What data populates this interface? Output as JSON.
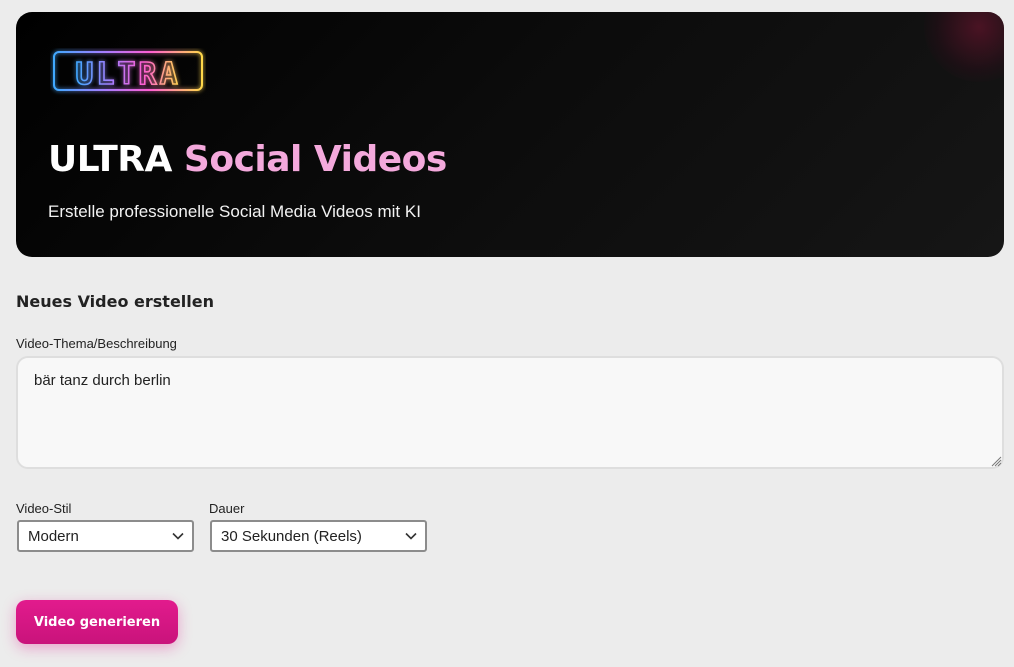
{
  "hero": {
    "logo_text": "ULTRA",
    "title_part1": "ULTRA",
    "title_part2": "Social Videos",
    "subtitle": "Erstelle professionelle Social Media Videos mit KI"
  },
  "form": {
    "heading": "Neues Video erstellen",
    "topic": {
      "label": "Video-Thema/Beschreibung",
      "value": "bär tanz durch berlin"
    },
    "style": {
      "label": "Video-Stil",
      "selected": "Modern"
    },
    "duration": {
      "label": "Dauer",
      "selected": "30 Sekunden (Reels)"
    },
    "submit_label": "Video generieren"
  },
  "colors": {
    "accent": "#e21b8d",
    "title_highlight": "#f4a9dc",
    "hero_background": "#0b0b0b",
    "page_background": "#ececec"
  },
  "icons": {
    "select_chevron": "chevron-down-icon",
    "textarea_grip": "resize-grip-icon"
  }
}
